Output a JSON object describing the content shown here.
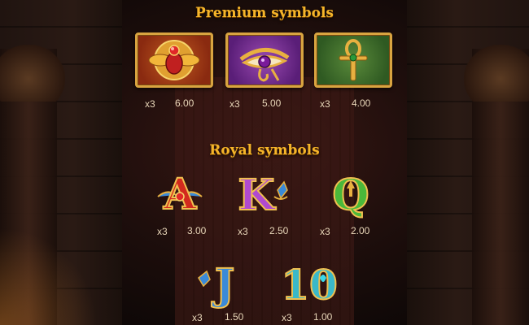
{
  "premium": {
    "heading": "Premium symbols",
    "symbols": [
      {
        "name": "scarab",
        "multiplier": "x3",
        "value": "6.00"
      },
      {
        "name": "eye-of-horus",
        "multiplier": "x3",
        "value": "5.00"
      },
      {
        "name": "ankh",
        "multiplier": "x3",
        "value": "4.00"
      }
    ]
  },
  "royal": {
    "heading": "Royal symbols",
    "symbols": [
      {
        "name": "A",
        "glyph": "A",
        "multiplier": "x3",
        "value": "3.00"
      },
      {
        "name": "K",
        "glyph": "K",
        "multiplier": "x3",
        "value": "2.50"
      },
      {
        "name": "Q",
        "glyph": "Q",
        "multiplier": "x3",
        "value": "2.00"
      },
      {
        "name": "J",
        "glyph": "J",
        "multiplier": "x3",
        "value": "1.50"
      },
      {
        "name": "10",
        "glyph": "10",
        "multiplier": "x3",
        "value": "1.00"
      }
    ]
  },
  "colors": {
    "heading": "#f5b52a",
    "text": "#e8d6b8",
    "A": "#d22a1e",
    "K": "#b04ad0",
    "Q": "#4ab83a",
    "J": "#3a8ad8",
    "10": "#3ab8c8"
  }
}
